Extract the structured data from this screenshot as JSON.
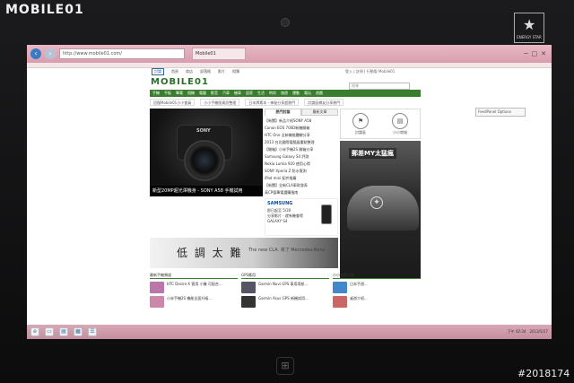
{
  "device": {
    "brand": "MOBILE01",
    "energy_label": "ENERGY STAR",
    "watermark": "#2018174"
  },
  "browser": {
    "address": "http://www.mobile01.com/",
    "tab_label": "Mobile01",
    "controls": [
      "─",
      "□",
      "✕"
    ]
  },
  "site": {
    "logo": "MOBILE01",
    "top_nav": [
      "討論",
      "首頁",
      "商店",
      "部落格",
      "影片",
      "相簿"
    ],
    "top_links": "登入 | 註冊 | 行動版 Mobile01",
    "search_placeholder": "搜尋",
    "menu": [
      "手機",
      "平板",
      "筆電",
      "相機",
      "電腦",
      "影音",
      "汽車",
      "機車",
      "居家",
      "生活",
      "時尚",
      "旅遊",
      "運動",
      "電玩",
      "遊戲"
    ],
    "sub_banners": [
      "回復Mobile01小小會員",
      "小小手機版資訊整理",
      "日本牌素本 - 神秘分享超熱門",
      "討論區網友分享熱門"
    ],
    "hero_caption": "新型20MP超光澤機身 - SONY A58 手機試用",
    "hero_brand": "SONY",
    "news_tabs": [
      "熱門討論",
      "最新文章"
    ],
    "news_items": [
      "【新聞】新品介紹SONY A58",
      "Canon EOS 700D新機開箱",
      "HTC One 全新機能體驗分享",
      "2013 台北國際電腦展重點整理",
      "【開箱】小米手機2S 開箱分享",
      "Samsung Galaxy S4 評測",
      "Nokia Lumia 920 使用心得",
      "SONY Xperia Z 防水實測",
      "iPad mini 配件推薦",
      "【新聞】全新CLA車款發表",
      "高CP值筆電選購指南"
    ],
    "side_icons": [
      {
        "glyph": "⚑",
        "label": "討論區"
      },
      {
        "glyph": "▤",
        "label": "小小商城"
      }
    ],
    "samsung": {
      "brand": "SAMSUNG",
      "line1": "即日起至 5/30",
      "line2": "分享影片 · 就有機會得",
      "highlight": "GALAXY S4"
    },
    "benz_headline": "郵差MY太猛瘋",
    "cla": {
      "big": "低 調 太 難",
      "small": "The new CLA. 來了 Mercedes-Benz"
    },
    "bottom_columns": [
      {
        "header": "最新手機頻道",
        "rows": [
          "HTC Desire X 實用 小機 可配合...",
          "小米手機2S 機能全面升級..."
        ]
      },
      {
        "header": "GPS應用",
        "rows": [
          "Garmin Nuvi GPS 車用導航...",
          "Garmin Asus GPS 新機試用..."
        ]
      },
      {
        "header": "小小遊戲討論",
        "rows": [
          "日本手遊...",
          "桌遊介紹..."
        ]
      }
    ],
    "mini_panel": "FeedPanel Options"
  },
  "taskbar": {
    "icons": [
      "e",
      "▭",
      "▤",
      "▦",
      "☰"
    ],
    "time": "下午 02:34",
    "date": "2013/5/27"
  }
}
